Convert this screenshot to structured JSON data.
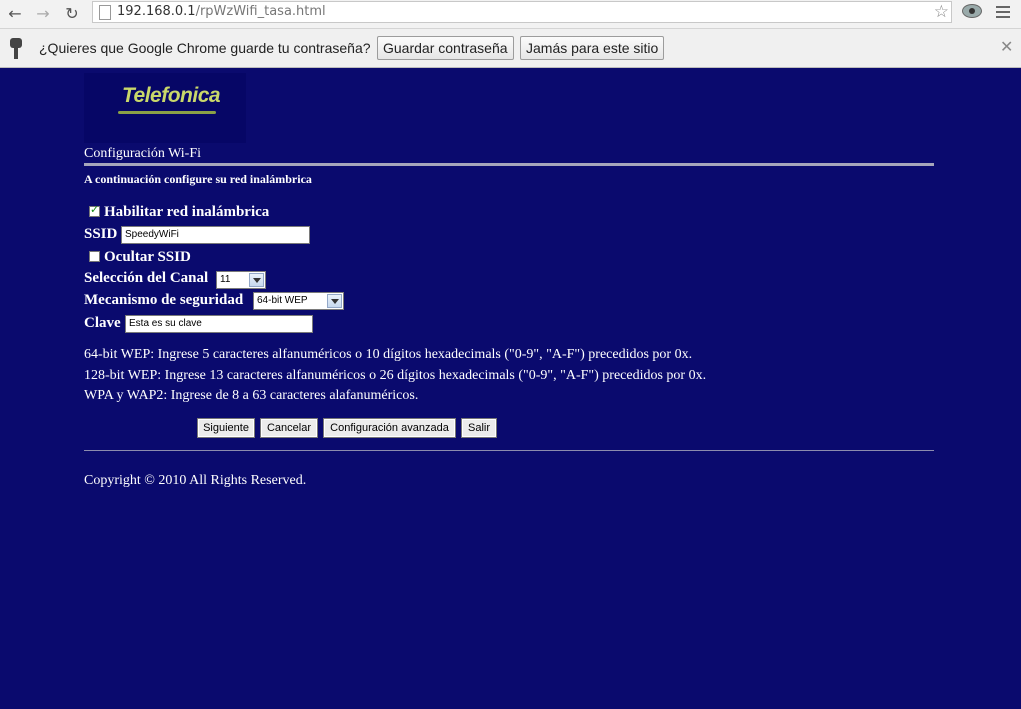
{
  "browser": {
    "url_host": "192.168.0.1",
    "url_path": "/rpWzWifi_tasa.html"
  },
  "infobar": {
    "message": "¿Quieres que Google Chrome guarde tu contraseña?",
    "save_label": "Guardar contraseña",
    "never_label": "Jamás para este sitio"
  },
  "page": {
    "logo_text": "Telefonica",
    "section_title": "Configuración Wi-Fi",
    "subtitle": "A continuación configure su red inalámbrica",
    "enable_label": "Habilitar red inalámbrica",
    "enable_checked": true,
    "ssid_label": "SSID",
    "ssid_value": "SpeedyWiFi",
    "hide_ssid_label": "Ocultar SSID",
    "hide_ssid_checked": false,
    "channel_label": "Selección del Canal",
    "channel_value": "11",
    "security_label": "Mecanismo de seguridad",
    "security_value": "64-bit WEP",
    "key_label": "Clave",
    "key_value": "Esta es su clave",
    "info": [
      "64-bit WEP: Ingrese 5 caracteres alfanuméricos o 10 dígitos hexadecimals (\"0-9\", \"A-F\") precedidos por 0x.",
      "128-bit WEP: Ingrese 13 caracteres alfanuméricos o 26 dígitos hexadecimals (\"0-9\", \"A-F\") precedidos por 0x.",
      "WPA y WAP2: Ingrese de 8 a 63 caracteres alafanuméricos."
    ],
    "buttons": {
      "next": "Siguiente",
      "cancel": "Cancelar",
      "advanced": "Configuración avanzada",
      "exit": "Salir"
    },
    "copyright": "Copyright © 2010 All Rights Reserved."
  }
}
